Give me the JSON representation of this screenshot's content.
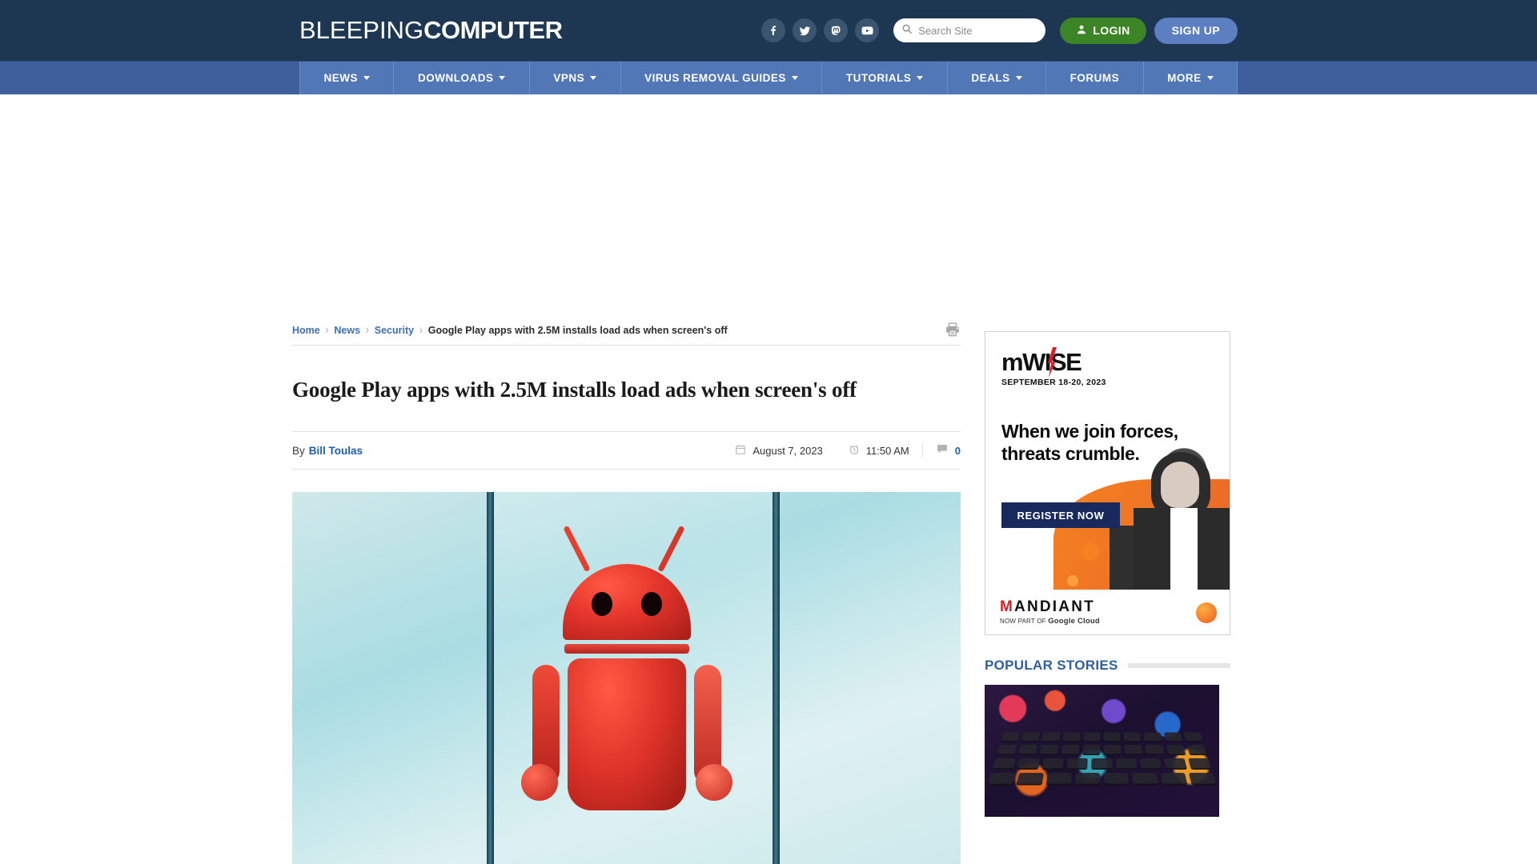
{
  "site": {
    "logo_thin": "BLEEPING",
    "logo_bold": "COMPUTER"
  },
  "header": {
    "social": [
      {
        "name": "facebook-icon",
        "label": "Facebook"
      },
      {
        "name": "twitter-icon",
        "label": "Twitter"
      },
      {
        "name": "mastodon-icon",
        "label": "Mastodon"
      },
      {
        "name": "youtube-icon",
        "label": "YouTube"
      }
    ],
    "search": {
      "placeholder": "Search Site",
      "value": "",
      "icon": "search-icon"
    },
    "login_label": "LOGIN",
    "signup_label": "SIGN UP",
    "login_color": "#3c8527",
    "signup_color": "#5b7fc0",
    "bar_color": "#1d3752"
  },
  "nav": {
    "bar_color": "#5277b6",
    "items": [
      {
        "label": "NEWS",
        "caret": true
      },
      {
        "label": "DOWNLOADS",
        "caret": true
      },
      {
        "label": "VPNS",
        "caret": true
      },
      {
        "label": "VIRUS REMOVAL GUIDES",
        "caret": true
      },
      {
        "label": "TUTORIALS",
        "caret": true
      },
      {
        "label": "DEALS",
        "caret": true
      },
      {
        "label": "FORUMS",
        "caret": false
      },
      {
        "label": "MORE",
        "caret": true
      }
    ]
  },
  "breadcrumb": {
    "home": "Home",
    "news": "News",
    "security": "Security",
    "current": "Google Play apps with 2.5M installs load ads when screen's off",
    "print_icon": "printer-icon"
  },
  "article": {
    "title": "Google Play apps with 2.5M installs load ads when screen's off",
    "by_label": "By",
    "author": "Bill Toulas",
    "date": "August 7, 2023",
    "time": "11:50 AM",
    "comments": "0",
    "hero_alt": "Red Android robot holding a smartphone"
  },
  "sidebar": {
    "ad": {
      "brand": "mWISE",
      "date_line": "SEPTEMBER 18-20, 2023",
      "headline": "When we join forces, threats crumble.",
      "cta": "REGISTER NOW",
      "sponsor_m": "M",
      "sponsor_rest": "ANDIANT",
      "sponsor_sub_pre": "NOW PART OF",
      "sponsor_sub_brand": "Google Cloud",
      "accent_red": "#d81f26",
      "cta_color": "#18295e"
    },
    "popular": {
      "title": "POPULAR STORIES",
      "title_color": "#2f5f9e"
    }
  }
}
